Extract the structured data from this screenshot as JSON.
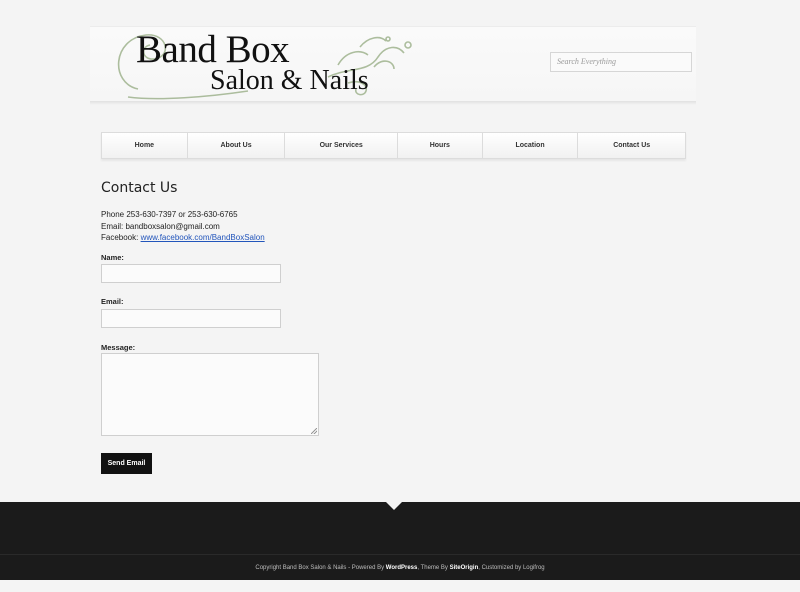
{
  "header": {
    "logo_line1": "Band Box",
    "logo_line2": "Salon & Nails",
    "search_placeholder": "Search Everything"
  },
  "nav": [
    {
      "label": "Home"
    },
    {
      "label": "About Us"
    },
    {
      "label": "Our Services"
    },
    {
      "label": "Hours"
    },
    {
      "label": "Location"
    },
    {
      "label": "Contact Us"
    }
  ],
  "page": {
    "title": "Contact Us",
    "phone_line": "Phone 253-630-7397 or 253-630-6765",
    "email_line": "Email: bandboxsalon@gmail.com",
    "facebook_prefix": "Facebook: ",
    "facebook_link": "www.facebook.com/BandBoxSalon"
  },
  "form": {
    "name_label": "Name:",
    "name_value": "",
    "email_label": "Email:",
    "email_value": "",
    "message_label": "Message:",
    "message_value": "",
    "submit_label": "Send Email"
  },
  "footer": {
    "copyright": "Copyright Band Box Salon & Nails - Powered By ",
    "wordpress": "WordPress",
    "theme_by": ", Theme By ",
    "siteorigin": "SiteOrigin",
    "customized": ", Customized by Logifrog"
  },
  "colors": {
    "background": "#f4f4f4",
    "footer": "#1b1b1b",
    "link": "#2255bb",
    "button": "#111111"
  }
}
